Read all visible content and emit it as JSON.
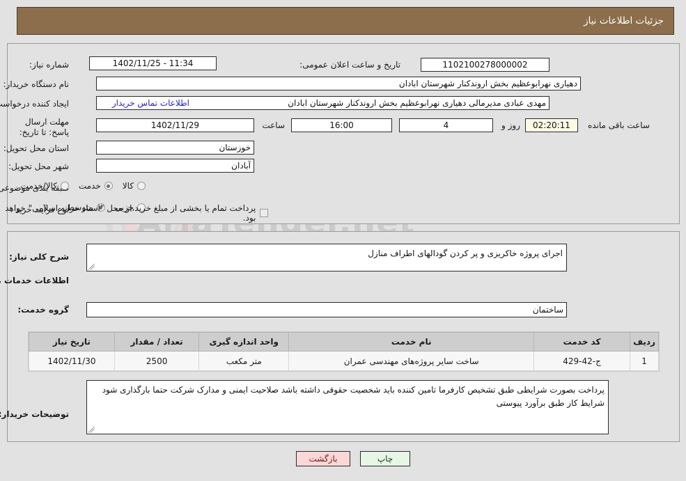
{
  "header": {
    "title": "جزئیات اطلاعات نیاز",
    "bg_color": "#8d6e4c"
  },
  "watermark": {
    "text": "AriaTender.net"
  },
  "top_section": {
    "need_number_label": "شماره نیاز:",
    "need_number_value": "1102100278000002",
    "announce_label": "تاریخ و ساعت اعلان عمومی:",
    "announce_value": "11:34 - 1402/11/25",
    "buyer_org_label": "نام دستگاه خریدار:",
    "buyer_org_value": "دهیاری نهرابوعظیم بخش اروندکنار شهرستان ابادان",
    "requester_label": "ایجاد کننده درخواست:",
    "requester_value": "مهدی عبادی مدیرمالی دهیاری نهرابوعظیم بخش اروندکنار شهرستان ابادان",
    "contact_link": "اطلاعات تماس خریدار",
    "deadline_label": "مهلت ارسال پاسخ: تا تاریخ:",
    "deadline_date": "1402/11/29",
    "hour_label": "ساعت",
    "hour_value": "16:00",
    "days_value": "4",
    "days_label": "روز و",
    "timer_value": "02:20:11",
    "timer_label": "ساعت باقی مانده",
    "province_label": "استان محل تحویل:",
    "province_value": "خوزستان",
    "city_label": "شهر محل تحویل:",
    "city_value": "آبادان",
    "category_label": "طبقه بندی موضوعی:",
    "category_options": [
      {
        "label": "کالا",
        "selected": false
      },
      {
        "label": "خدمت",
        "selected": true
      },
      {
        "label": "کالا/خدمت",
        "selected": false
      }
    ],
    "process_label": "نوع فرآیند خرید :",
    "process_options": [
      {
        "label": "جزیی",
        "selected": false
      },
      {
        "label": "متوسط",
        "selected": true
      }
    ],
    "treasury_checkbox_checked": false,
    "treasury_note": "پرداخت تمام یا بخشی از مبلغ خرید،از محل \"اسناد خزانه اسلامی\" خواهد بود."
  },
  "bottom_section": {
    "general_desc_label": "شرح کلی نیاز:",
    "general_desc_value": "اجرای پروژه خاکریزی و پر کردن گودالهای اطراف منازل",
    "services_info_heading": "اطلاعات خدمات مورد نیاز",
    "service_group_label": "گروه خدمت:",
    "service_group_value": "ساختمان",
    "buyer_notes_label": "توضیحات خریدار:",
    "buyer_notes_value": "پرداخت بصورت شرایطی طبق تشخیص کارفرما تامین کننده باید شخصیت حقوقی داشته باشد صلاحیت ایمنی و مدارک شرکت حتما بارگذاری شود شرایط کار طبق برآورد پیوستی"
  },
  "table": {
    "headers": [
      "ردیف",
      "کد خدمت",
      "نام خدمت",
      "واحد اندازه گیری",
      "تعداد / مقدار",
      "تاریخ نیاز"
    ],
    "rows": [
      {
        "row_no": "1",
        "service_code": "ج-42-429",
        "service_name": "ساخت سایر پروژه‌های مهندسی عمران",
        "unit": "متر مکعب",
        "quantity": "2500",
        "need_date": "1402/11/30"
      }
    ]
  },
  "footer": {
    "print_label": "چاپ",
    "return_label": "بازگشت"
  }
}
